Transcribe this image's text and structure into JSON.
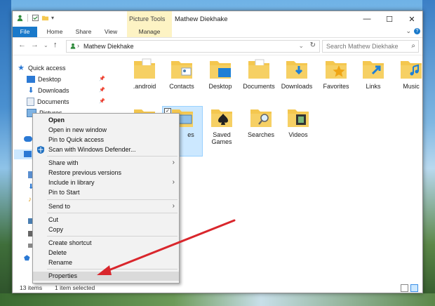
{
  "window": {
    "title": "Mathew Diekhake",
    "context_tab": "Picture Tools",
    "minimize": "—",
    "maximize": "☐",
    "close": "✕"
  },
  "ribbon": {
    "tabs": [
      "File",
      "Home",
      "Share",
      "View",
      "Manage"
    ],
    "help": "?"
  },
  "address": {
    "path": "Mathew Diekhake",
    "search_placeholder": "Search Mathew Diekhake"
  },
  "nav": {
    "items": [
      {
        "label": "Quick access"
      },
      {
        "label": "Desktop"
      },
      {
        "label": "Downloads"
      },
      {
        "label": "Documents"
      },
      {
        "label": "Pictures"
      }
    ]
  },
  "folders": {
    "row1": [
      ".android",
      "Contacts",
      "Desktop",
      "Documents",
      "Downloads",
      "Favorites",
      "Links",
      "Music"
    ],
    "row2": [
      "es",
      "Saved Games",
      "Searches",
      "Videos"
    ]
  },
  "status": {
    "count": "13 items",
    "selected": "1 item selected"
  },
  "context_menu": {
    "items": [
      "Open",
      "Open in new window",
      "Pin to Quick access",
      "Scan with Windows Defender...",
      "Share with",
      "Restore previous versions",
      "Include in library",
      "Pin to Start",
      "Send to",
      "Cut",
      "Copy",
      "Create shortcut",
      "Delete",
      "Rename",
      "Properties"
    ]
  },
  "colors": {
    "accent": "#1979ca",
    "context_tab": "#fdf3c4",
    "folder": "#f4c74f",
    "arrow": "#d9262c"
  }
}
